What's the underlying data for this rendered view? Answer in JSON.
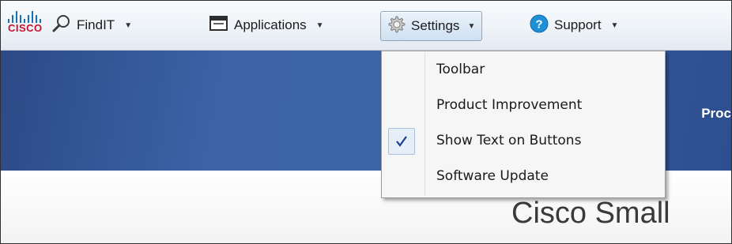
{
  "brand": {
    "logo_text": "CISCO",
    "logo_color": "#c8102e",
    "bars_color": "#1b6fb5"
  },
  "toolbar": {
    "items": [
      {
        "label": "FindIT",
        "icon": "search-icon"
      },
      {
        "label": "Applications",
        "icon": "window-icon"
      },
      {
        "label": "Settings",
        "icon": "gear-icon",
        "active": true
      },
      {
        "label": "Support",
        "icon": "help-icon"
      }
    ]
  },
  "settings_menu": {
    "items": [
      {
        "label": "Toolbar",
        "checked": false
      },
      {
        "label": "Product Improvement",
        "checked": false
      },
      {
        "label": "Show Text on Buttons",
        "checked": true
      },
      {
        "label": "Software Update",
        "checked": false
      }
    ]
  },
  "banner": {
    "partial_text": "Proc",
    "color": "#3b63a6"
  },
  "page": {
    "title_partial": "Cisco Small"
  }
}
